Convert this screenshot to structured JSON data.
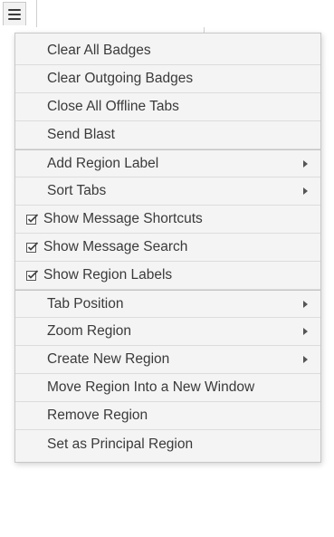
{
  "menu_toggle": {
    "icon": "hamburger-menu-icon"
  },
  "menu": {
    "items": [
      {
        "label": "Clear All Badges",
        "checked": false,
        "submenu": false
      },
      {
        "label": "Clear Outgoing Badges",
        "checked": false,
        "submenu": false
      },
      {
        "label": "Close All Offline Tabs",
        "checked": false,
        "submenu": false
      },
      {
        "label": "Send Blast",
        "checked": false,
        "submenu": false
      },
      {
        "label": "Add Region Label",
        "checked": false,
        "submenu": true
      },
      {
        "label": "Sort Tabs",
        "checked": false,
        "submenu": true
      },
      {
        "label": "Show Message Shortcuts",
        "checked": true,
        "submenu": false
      },
      {
        "label": "Show Message Search",
        "checked": true,
        "submenu": false
      },
      {
        "label": "Show Region Labels",
        "checked": true,
        "submenu": false
      },
      {
        "label": "Tab Position",
        "checked": false,
        "submenu": true
      },
      {
        "label": "Zoom Region",
        "checked": false,
        "submenu": true
      },
      {
        "label": "Create New Region",
        "checked": false,
        "submenu": true
      },
      {
        "label": "Move Region Into a New Window",
        "checked": false,
        "submenu": false
      },
      {
        "label": "Remove Region",
        "checked": false,
        "submenu": false
      },
      {
        "label": "Set as Principal Region",
        "checked": false,
        "submenu": false
      }
    ]
  }
}
